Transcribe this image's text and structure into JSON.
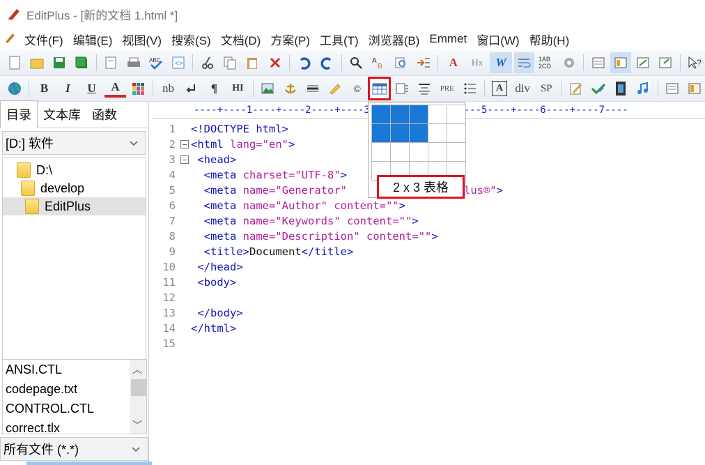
{
  "window": {
    "title": "EditPlus - [新的文档 1.html *]"
  },
  "menu": [
    "文件(F)",
    "编辑(E)",
    "视图(V)",
    "搜索(S)",
    "文档(D)",
    "方案(P)",
    "工具(T)",
    "浏览器(B)",
    "Emmet",
    "窗口(W)",
    "帮助(H)"
  ],
  "toolbar2_text": {
    "nb": "nb",
    "pre": "PRE",
    "div": "div",
    "sp": "SP",
    "hi": "HI",
    "b": "B",
    "i": "I",
    "u": "U",
    "a": "A",
    "hx": "Hx",
    "w": "W",
    "abc": "ABC"
  },
  "left_panel": {
    "tabs": [
      "目录",
      "文本库",
      "函数"
    ],
    "drive": "[D:] 软件",
    "tree": [
      {
        "label": "D:\\"
      },
      {
        "label": "develop"
      },
      {
        "label": "EditPlus"
      }
    ],
    "files": [
      "ANSI.CTL",
      "codepage.txt",
      "CONTROL.CTL",
      "correct.tlx"
    ],
    "filter": "所有文件 (*.*)"
  },
  "editor": {
    "ruler": "----+----1----+----2----+----3----+----4----+----5----+----6----+----7----",
    "line_numbers": [
      "1",
      "2",
      "3",
      "4",
      "5",
      "6",
      "7",
      "8",
      "9",
      "10",
      "11",
      "12",
      "13",
      "14",
      "15"
    ]
  },
  "table_popup": {
    "label": "2 x 3 表格",
    "rows_selected": 2,
    "cols_selected": 3
  }
}
